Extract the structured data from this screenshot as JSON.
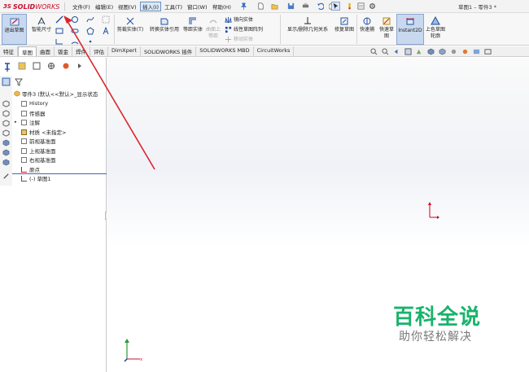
{
  "app": {
    "logo_ds": "3S",
    "logo_text1": "SOLID",
    "logo_text2": "WORKS",
    "doc_title": "草图1 – 零件3 *"
  },
  "menus": [
    "文件(F)",
    "编辑(E)",
    "视图(V)",
    "插入(I)",
    "工具(T)",
    "窗口(W)",
    "帮助(H)"
  ],
  "active_menu_index": 3,
  "ribbon": {
    "exit_sketch": "退出草图",
    "smart_dim": "智能尺寸",
    "trim": "剪裁实体(T)",
    "convert": "转换实体引用",
    "offset": "等距实体",
    "surface_offset": "曲面上等距",
    "mirror": "镜向实体",
    "linear_pattern": "线性草图阵列",
    "move": "移动实体",
    "display_relations": "显示/删除几何关系",
    "repair": "修复草图",
    "quick_snap": "快速捕",
    "rapid_sketch": "快速草图",
    "instant2d": "Instant2D",
    "shaded_sketch": "上色草图轮廓"
  },
  "tabs": [
    "特征",
    "草图",
    "曲面",
    "钣金",
    "焊件",
    "评估",
    "DimXpert",
    "SOLIDWORKS 插件",
    "SOLIDWORKS MBD",
    "CircuitWorks"
  ],
  "selected_tab_index": 1,
  "tree": {
    "root": "零件3 (默认<<默认>_显示状态",
    "items": [
      "History",
      "传感器",
      "注解",
      "材质 <未指定>",
      "前视基准面",
      "上视基准面",
      "右视基准面",
      "原点",
      "(-) 草图1"
    ]
  },
  "watermark": {
    "title": "百科全说",
    "subtitle": "助你轻松解决"
  },
  "colors": {
    "accent": "#c8102e",
    "arrow": "#d9262c",
    "watermark": "#19b36b",
    "origin_red": "#d0021b",
    "axis_green": "#2c9a3a",
    "axis_blue": "#1b3fa8"
  }
}
